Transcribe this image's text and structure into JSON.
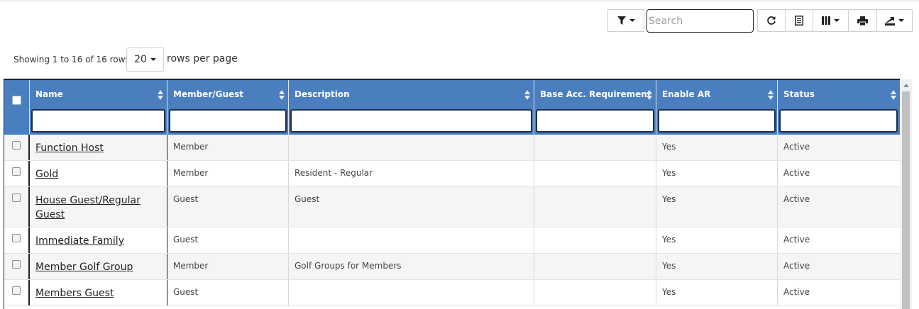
{
  "toolbar": {
    "filter_icon": "filter-icon",
    "search_placeholder": "Search",
    "refresh_icon": "refresh-icon",
    "toggle_view_icon": "list-view-icon",
    "columns_icon": "columns-icon",
    "print_icon": "print-icon",
    "export_icon": "export-icon"
  },
  "pagination": {
    "showing": "Showing 1 to 16 of 16 rows",
    "page_size": "20",
    "rows_per_page": "rows per page"
  },
  "table": {
    "columns": [
      "Name",
      "Member/Guest",
      "Description",
      "Base Acc. Requirement",
      "Enable AR",
      "Status"
    ],
    "rows": [
      {
        "name": "Function Host",
        "type": "Member",
        "description": "",
        "base_acc": "",
        "enable_ar": "Yes",
        "status": "Active"
      },
      {
        "name": "Gold",
        "type": "Member",
        "description": "Resident - Regular",
        "base_acc": "",
        "enable_ar": "Yes",
        "status": "Active"
      },
      {
        "name": "House Guest/Regular Guest",
        "type": "Guest",
        "description": "Guest",
        "base_acc": "",
        "enable_ar": "Yes",
        "status": "Active"
      },
      {
        "name": "Immediate Family",
        "type": "Guest",
        "description": "",
        "base_acc": "",
        "enable_ar": "Yes",
        "status": "Active"
      },
      {
        "name": "Member Golf Group",
        "type": "Member",
        "description": "Golf Groups for Members",
        "base_acc": "",
        "enable_ar": "Yes",
        "status": "Active"
      },
      {
        "name": "Members Guest",
        "type": "Guest",
        "description": "",
        "base_acc": "",
        "enable_ar": "Yes",
        "status": "Active"
      }
    ]
  },
  "colors": {
    "header_bg": "#4a7ebf",
    "header_text": "#ffffff",
    "row_alt_bg": "#f5f5f5"
  }
}
